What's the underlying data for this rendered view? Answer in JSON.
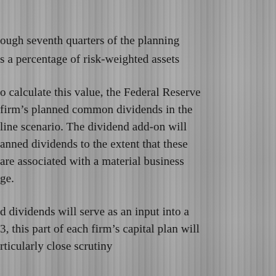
{
  "document": {
    "lines": [
      "ough seventh quarters of the planning",
      "s a percentage of risk-weighted assets",
      "o calculate this value, the Federal Reserve",
      "firm’s planned common dividends in the",
      "line scenario. The dividend add-on will",
      "anned dividends to the extent that these",
      "are associated with a material business",
      "ge.",
      "d dividends will serve as an input into a",
      "3, this part of each firm’s capital plan will",
      "rticularly close scrutiny"
    ]
  }
}
